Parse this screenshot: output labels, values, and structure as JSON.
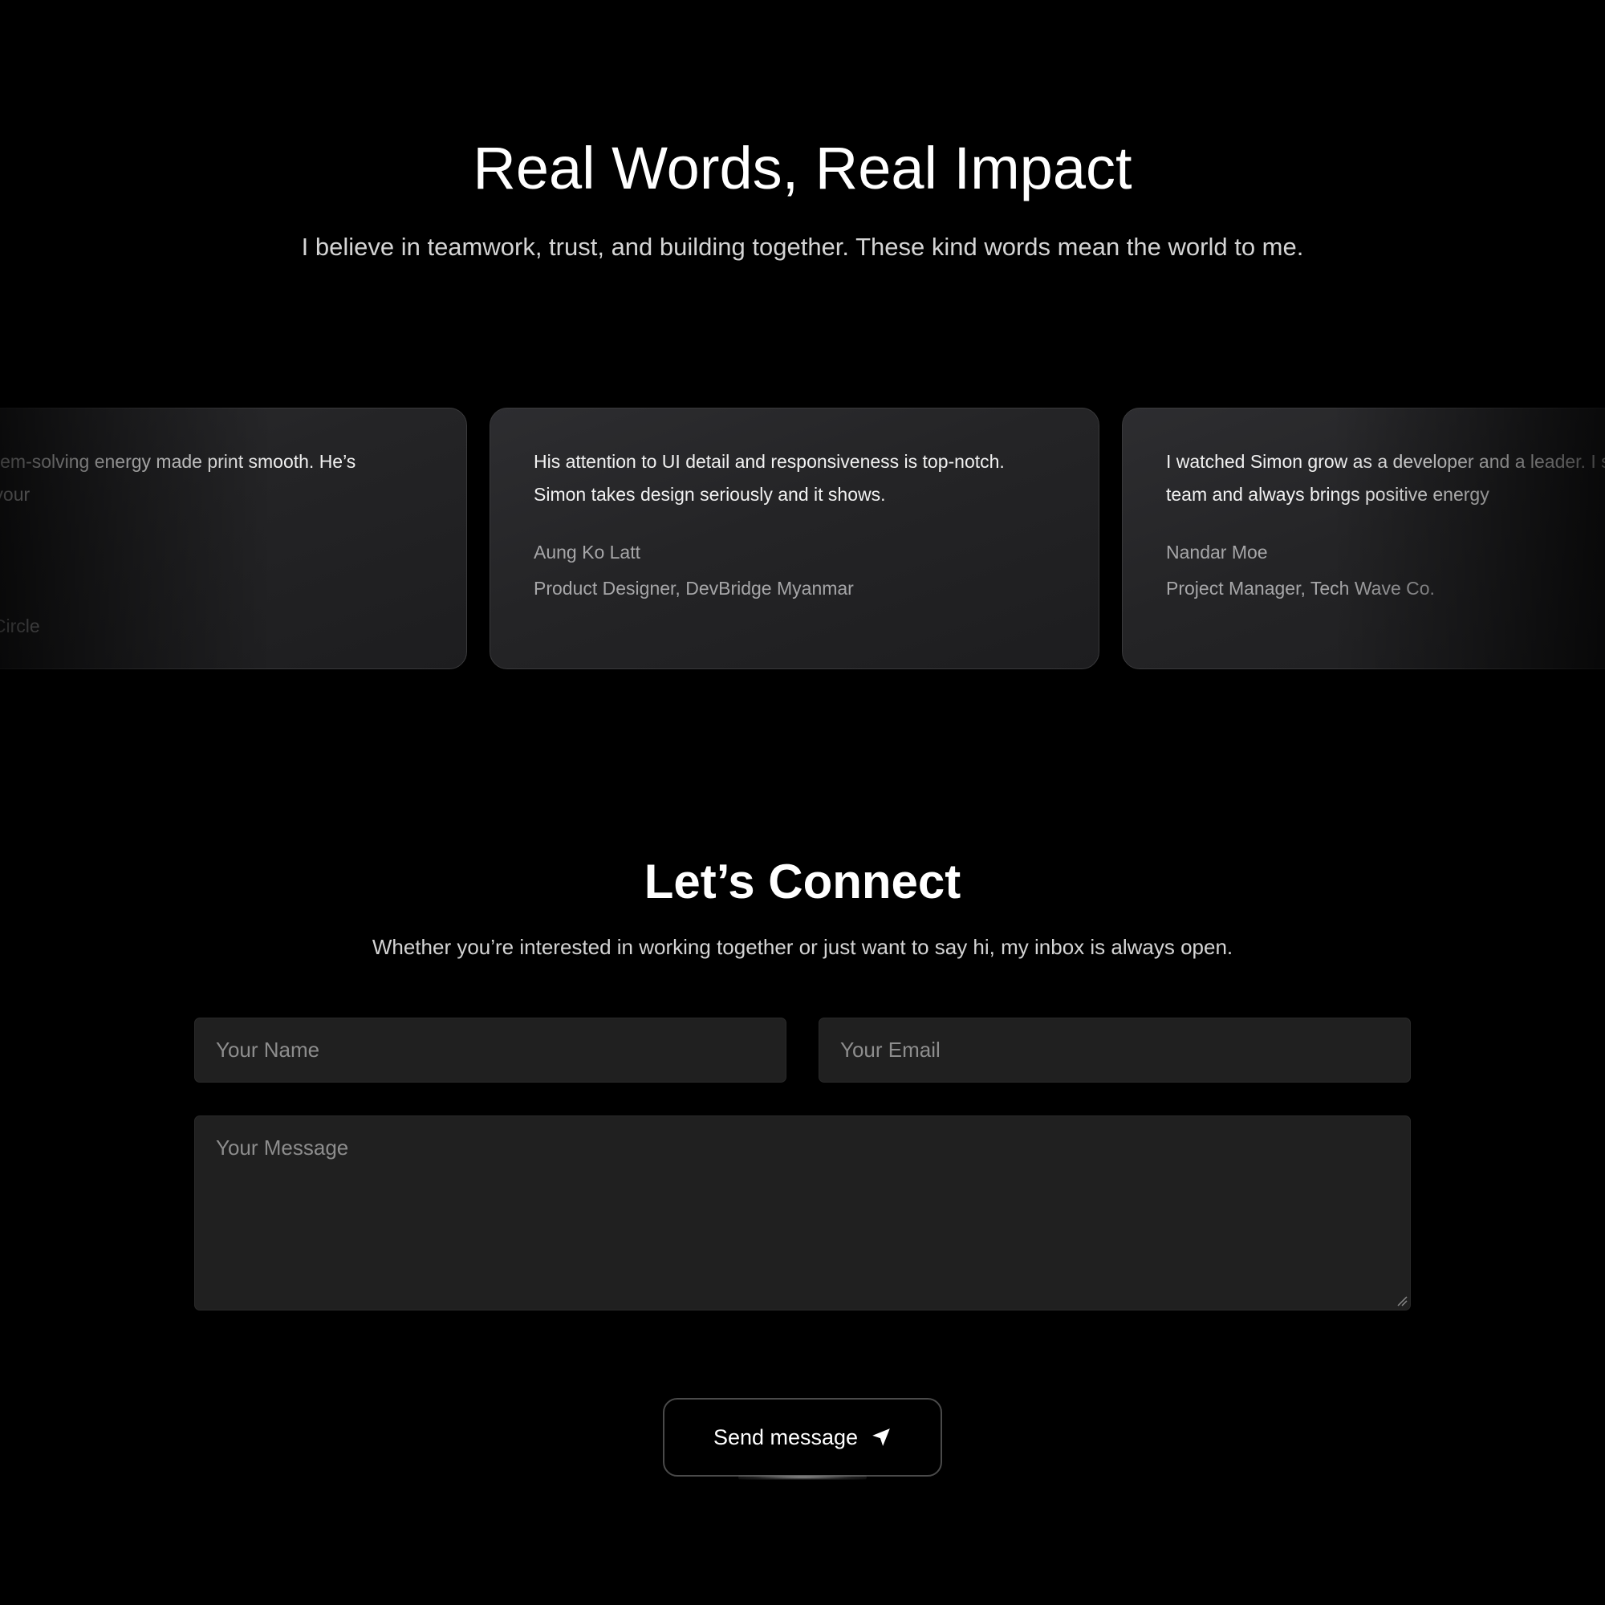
{
  "testimonials": {
    "title": "Real Words, Real Impact",
    "subtitle": "I believe in teamwork, trust, and building together. These kind words mean the world to me.",
    "cards": [
      {
        "quote": "nsistency and calm problem-solving energy made print smooth. He’s someone you want on your",
        "name": "",
        "role": "eveloper, Yangon Tech Circle"
      },
      {
        "quote": "His attention to UI detail and responsiveness is top-notch. Simon takes design seriously and it shows.",
        "name": "Aung Ko Latt",
        "role": "Product Designer, DevBridge Myanmar"
      },
      {
        "quote": "I watched Simon grow as a developer and a leader. I supports his team and always brings positive energy",
        "name": "Nandar Moe",
        "role": "Project Manager, Tech Wave Co."
      }
    ]
  },
  "contact": {
    "title": "Let’s Connect",
    "subtitle": "Whether you’re interested in working together or just want to say hi, my inbox is always open.",
    "name_placeholder": "Your Name",
    "email_placeholder": "Your Email",
    "message_placeholder": "Your Message",
    "send_label": "Send message",
    "send_icon": "send-arrow-icon"
  }
}
